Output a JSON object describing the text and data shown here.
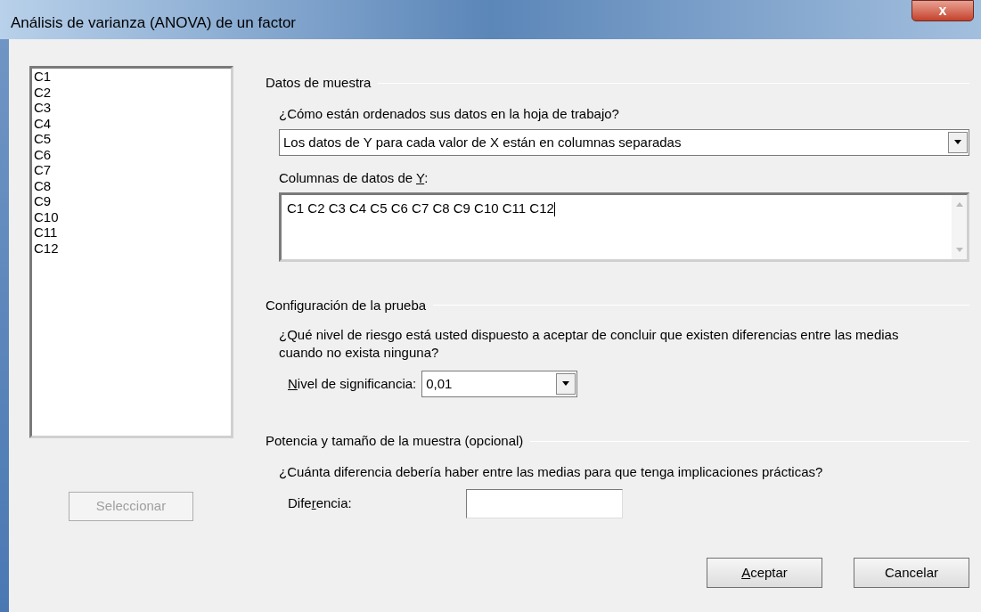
{
  "window": {
    "title": "Análisis de varianza (ANOVA) de un factor",
    "close": "x"
  },
  "variables": {
    "items": [
      "C1",
      "C2",
      "C3",
      "C4",
      "C5",
      "C6",
      "C7",
      "C8",
      "C9",
      "C10",
      "C11",
      "C12"
    ],
    "select_button": {
      "label": "Seleccionar",
      "disabled": true
    }
  },
  "sections": [
    {
      "kind": "data",
      "heading": "Datos de muestra",
      "question": "¿Cómo están ordenados sus datos en la hoja de trabajo?",
      "arrangement": "Los datos de Y para cada valor de X están en columnas separadas",
      "columns_label": {
        "before": "Columnas de datos de ",
        "accel": "Y",
        "after": ":"
      },
      "columns_value": "C1 C2 C3 C4 C5 C6 C7 C8 C9 C10 C11 C12"
    },
    {
      "kind": "test",
      "heading": "Configuración de la prueba",
      "question": "¿Qué nivel de riesgo está usted dispuesto a aceptar de concluir que existen diferencias entre las medias cuando no exista ninguna?",
      "field_label": {
        "accel": "N",
        "after": "ivel de significancia:"
      },
      "field_value": "0,01"
    },
    {
      "kind": "power",
      "heading": "Potencia y tamaño de la muestra (opcional)",
      "question": "¿Cuánta diferencia debería haber entre las medias para que tenga implicaciones prácticas?",
      "field_label": {
        "before": "Dife",
        "accel": "r",
        "after": "encia:"
      }
    }
  ],
  "buttons": [
    {
      "accel": "A",
      "after": "ceptar"
    },
    {
      "before": "Cancelar"
    }
  ]
}
